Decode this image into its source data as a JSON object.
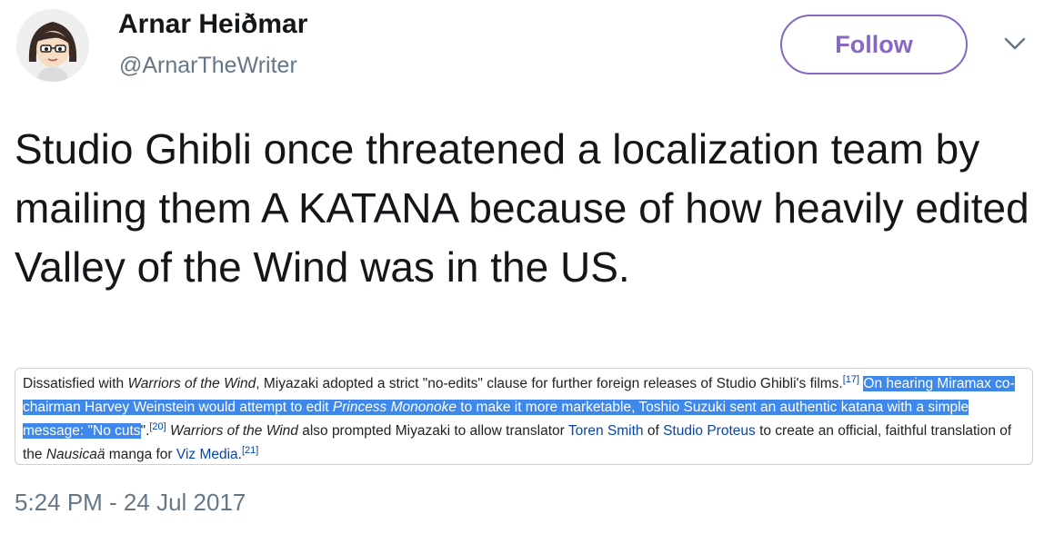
{
  "tweet": {
    "author_name": "Arnar Heiðmar",
    "author_handle": "@ArnarTheWriter",
    "follow_label": "Follow",
    "menu_icon": "chevron-down-icon",
    "text": "Studio Ghibli once threatened a localization team by mailing them A KATANA because of how heavily edited Valley of the Wind was in the US.",
    "timestamp": "5:24 PM - 24 Jul 2017"
  },
  "quote_card": {
    "s1": "Dissatisfied with ",
    "s2": "Warriors of the Wind",
    "s3": ", Miyazaki adopted a strict \"no-edits\" clause for further foreign releases of Studio Ghibli's films.",
    "ref1": "[17]",
    "h1": "On hearing Miramax co-chairman Harvey Weinstein would attempt to edit ",
    "h2": "Princess Mononoke",
    "h3": " to make it more marketable, Toshio Suzuki sent an authentic katana with a simple message: \"No cuts",
    "s4": "\".",
    "ref2": "[20]",
    "s5": "Warriors of the Wind",
    "s6": " also prompted Miyazaki to allow translator ",
    "link1": "Toren Smith",
    "s7": " of ",
    "link2": "Studio Proteus",
    "s8": " to create an official, faithful translation of the ",
    "s9": "Nausicaä",
    "s10": " manga for ",
    "link3": "Viz Media",
    "s11": ".",
    "ref3": "[21]"
  },
  "colors": {
    "follow_accent": "#8767c4",
    "highlight": "#3d88ea",
    "link": "#0645ad",
    "secondary_text": "#657786"
  }
}
